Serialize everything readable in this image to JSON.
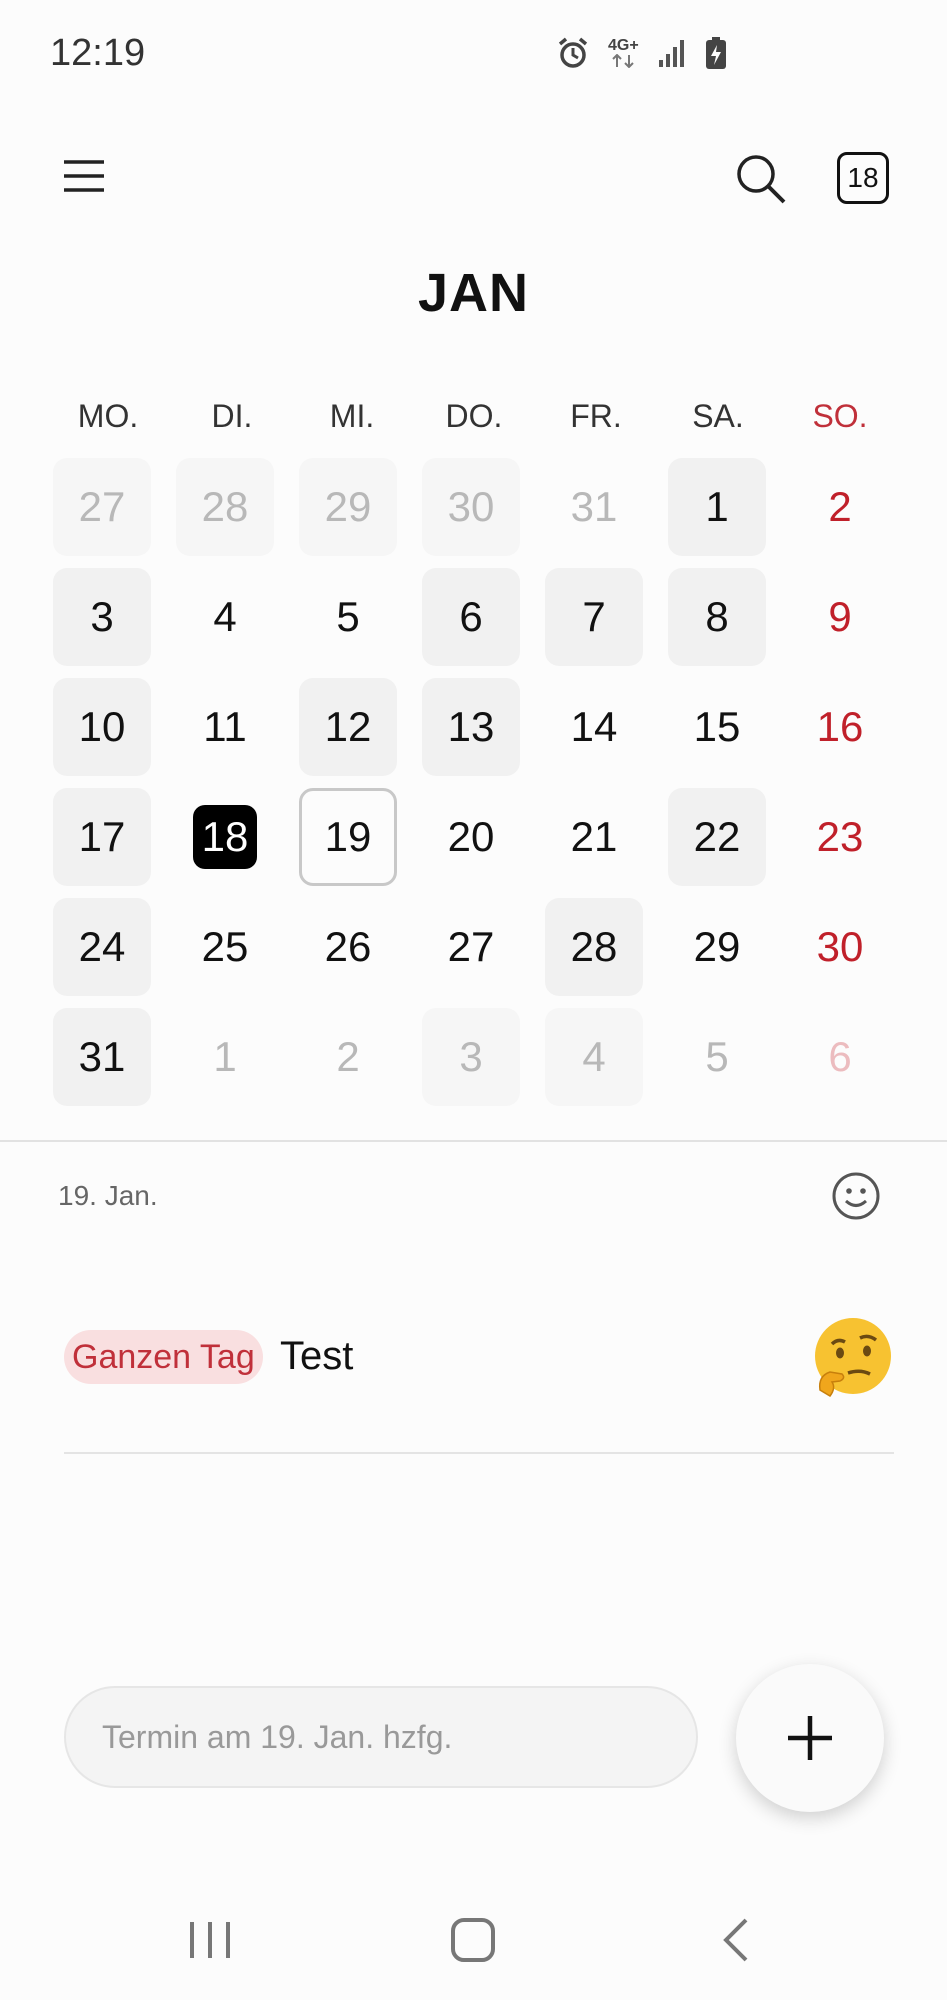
{
  "status_bar": {
    "time": "12:19",
    "network": "4G+",
    "icons": [
      "alarm-icon",
      "network-4g-icon",
      "signal-icon",
      "battery-charging-icon"
    ]
  },
  "app_bar": {
    "menu_icon": "hamburger-menu-icon",
    "search_icon": "search-icon",
    "today_button_label": "18"
  },
  "calendar": {
    "month_title": "JAN",
    "weekdays": [
      "MO.",
      "DI.",
      "MI.",
      "DO.",
      "FR.",
      "SA.",
      "SO."
    ],
    "weeks": [
      [
        {
          "day": "27",
          "in_month": false,
          "has_event": true
        },
        {
          "day": "28",
          "in_month": false,
          "has_event": true
        },
        {
          "day": "29",
          "in_month": false,
          "has_event": true
        },
        {
          "day": "30",
          "in_month": false,
          "has_event": true
        },
        {
          "day": "31",
          "in_month": false,
          "has_event": false
        },
        {
          "day": "1",
          "in_month": true,
          "has_event": true
        },
        {
          "day": "2",
          "in_month": true,
          "has_event": false
        }
      ],
      [
        {
          "day": "3",
          "in_month": true,
          "has_event": true
        },
        {
          "day": "4",
          "in_month": true,
          "has_event": false
        },
        {
          "day": "5",
          "in_month": true,
          "has_event": false
        },
        {
          "day": "6",
          "in_month": true,
          "has_event": true
        },
        {
          "day": "7",
          "in_month": true,
          "has_event": true
        },
        {
          "day": "8",
          "in_month": true,
          "has_event": true
        },
        {
          "day": "9",
          "in_month": true,
          "has_event": false
        }
      ],
      [
        {
          "day": "10",
          "in_month": true,
          "has_event": true
        },
        {
          "day": "11",
          "in_month": true,
          "has_event": false
        },
        {
          "day": "12",
          "in_month": true,
          "has_event": true
        },
        {
          "day": "13",
          "in_month": true,
          "has_event": true
        },
        {
          "day": "14",
          "in_month": true,
          "has_event": false
        },
        {
          "day": "15",
          "in_month": true,
          "has_event": false
        },
        {
          "day": "16",
          "in_month": true,
          "has_event": false
        }
      ],
      [
        {
          "day": "17",
          "in_month": true,
          "has_event": true
        },
        {
          "day": "18",
          "in_month": true,
          "has_event": false,
          "today": true
        },
        {
          "day": "19",
          "in_month": true,
          "has_event": false,
          "selected": true
        },
        {
          "day": "20",
          "in_month": true,
          "has_event": false
        },
        {
          "day": "21",
          "in_month": true,
          "has_event": false
        },
        {
          "day": "22",
          "in_month": true,
          "has_event": true
        },
        {
          "day": "23",
          "in_month": true,
          "has_event": false
        }
      ],
      [
        {
          "day": "24",
          "in_month": true,
          "has_event": true
        },
        {
          "day": "25",
          "in_month": true,
          "has_event": false
        },
        {
          "day": "26",
          "in_month": true,
          "has_event": false
        },
        {
          "day": "27",
          "in_month": true,
          "has_event": false
        },
        {
          "day": "28",
          "in_month": true,
          "has_event": true
        },
        {
          "day": "29",
          "in_month": true,
          "has_event": false
        },
        {
          "day": "30",
          "in_month": true,
          "has_event": false
        }
      ],
      [
        {
          "day": "31",
          "in_month": true,
          "has_event": true
        },
        {
          "day": "1",
          "in_month": false,
          "has_event": false
        },
        {
          "day": "2",
          "in_month": false,
          "has_event": false
        },
        {
          "day": "3",
          "in_month": false,
          "has_event": true
        },
        {
          "day": "4",
          "in_month": false,
          "has_event": true
        },
        {
          "day": "5",
          "in_month": false,
          "has_event": false
        },
        {
          "day": "6",
          "in_month": false,
          "has_event": false
        }
      ]
    ]
  },
  "day_detail": {
    "date_label": "19. Jan.",
    "sticker_icon": "smiley-icon",
    "events": [
      {
        "badge": "Ganzen Tag",
        "title": "Test",
        "emoji": "thinking-face-emoji"
      }
    ]
  },
  "quick_add": {
    "placeholder": "Termin am 19. Jan. hzfg.",
    "fab_icon": "plus-icon"
  },
  "nav_bar": {
    "buttons": [
      "recent-apps-icon",
      "home-icon",
      "back-icon"
    ]
  },
  "colors": {
    "sunday": "#c0202a",
    "today_bg": "#000000",
    "badge_bg": "#f9dfe0",
    "badge_text": "#c0303a",
    "cell_bg": "#f1f1f1"
  }
}
